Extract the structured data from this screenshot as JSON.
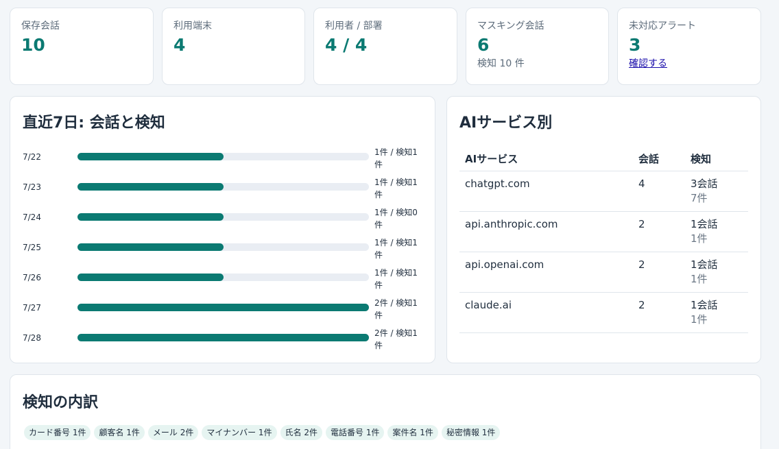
{
  "stats": [
    {
      "label": "保存会話",
      "value": "10"
    },
    {
      "label": "利用端末",
      "value": "4"
    },
    {
      "label": "利用者 / 部署",
      "value": "4 / 4"
    },
    {
      "label": "マスキング会話",
      "value": "6",
      "sub": "検知 10 件"
    },
    {
      "label": "未対応アラート",
      "value": "3",
      "link": "確認する"
    }
  ],
  "daily": {
    "title": "直近7日: 会話と検知",
    "rows": [
      {
        "date": "7/22",
        "text": "1件 / 検知1件"
      },
      {
        "date": "7/23",
        "text": "1件 / 検知1件"
      },
      {
        "date": "7/24",
        "text": "1件 / 検知0件"
      },
      {
        "date": "7/25",
        "text": "1件 / 検知1件"
      },
      {
        "date": "7/26",
        "text": "1件 / 検知1件"
      },
      {
        "date": "7/27",
        "text": "2件 / 検知1件"
      },
      {
        "date": "7/28",
        "text": "2件 / 検知1件"
      }
    ]
  },
  "chart_data": {
    "type": "bar",
    "categories": [
      "7/22",
      "7/23",
      "7/24",
      "7/25",
      "7/26",
      "7/27",
      "7/28"
    ],
    "series": [
      {
        "name": "",
        "values": [
          1,
          1,
          1,
          1,
          1,
          2,
          2
        ]
      }
    ],
    "detections": [
      1,
      1,
      0,
      1,
      1,
      1,
      1
    ],
    "xlim": [
      0,
      2
    ]
  },
  "services": {
    "title": "AIサービス別",
    "headers": [
      "AIサービス",
      "会話",
      "検知"
    ],
    "rows": [
      {
        "name": "chatgpt.com",
        "conversations": "4",
        "detect_conv": "3会話",
        "detect_count": "7件"
      },
      {
        "name": "api.anthropic.com",
        "conversations": "2",
        "detect_conv": "1会話",
        "detect_count": "1件"
      },
      {
        "name": "api.openai.com",
        "conversations": "2",
        "detect_conv": "1会話",
        "detect_count": "1件"
      },
      {
        "name": "claude.ai",
        "conversations": "2",
        "detect_conv": "1会話",
        "detect_count": "1件"
      }
    ]
  },
  "breakdown": {
    "title": "検知の内訳",
    "badges": [
      "カード番号 1件",
      "顧客名 1件",
      "メール 2件",
      "マイナンバー 1件",
      "氏名 2件",
      "電話番号 1件",
      "案件名 1件",
      "秘密情報 1件"
    ]
  },
  "colors": {
    "accent": "#0b7a72",
    "track": "#e9edf3",
    "badge_bg": "#e6f4f1",
    "link": "#1a0dab"
  }
}
